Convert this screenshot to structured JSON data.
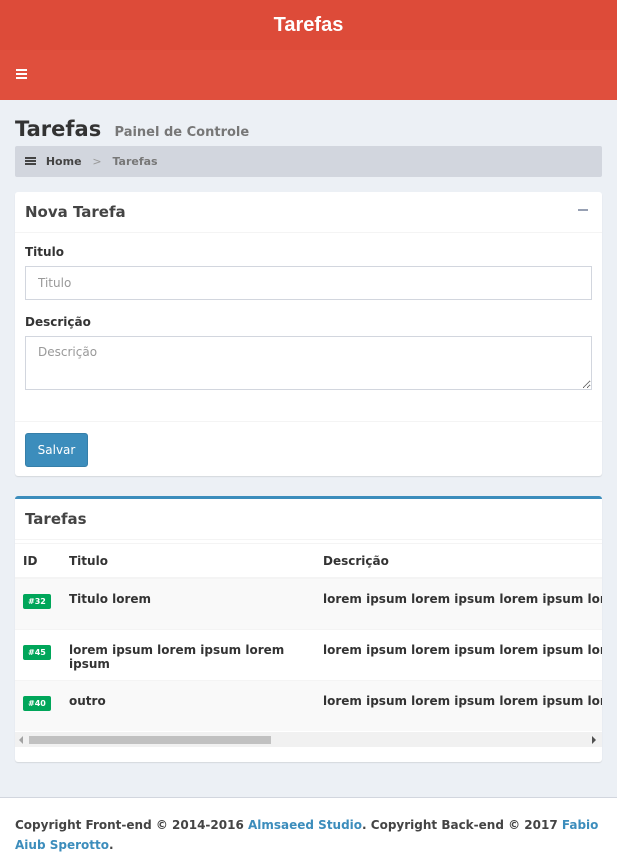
{
  "app": {
    "title": "Tarefas"
  },
  "header": {
    "title": "Tarefas",
    "subtitle": "Painel de Controle"
  },
  "breadcrumb": {
    "home": "Home",
    "separator": ">",
    "current": "Tarefas"
  },
  "form": {
    "box_title": "Nova Tarefa",
    "title_label": "Titulo",
    "title_placeholder": "Titulo",
    "description_label": "Descrição",
    "description_placeholder": "Descrição",
    "save_label": "Salvar"
  },
  "tasks": {
    "box_title": "Tarefas",
    "columns": [
      "ID",
      "Titulo",
      "Descrição"
    ],
    "rows": [
      {
        "id": "#32",
        "title": "Titulo lorem",
        "description": "lorem ipsum lorem ipsum lorem ipsum lorem"
      },
      {
        "id": "#45",
        "title": "lorem ipsum lorem ipsum lorem ipsum",
        "description": "lorem ipsum lorem ipsum lorem ipsum lorem"
      },
      {
        "id": "#40",
        "title": "outro",
        "description": "lorem ipsum lorem ipsum lorem ipsum lorem"
      }
    ]
  },
  "footer": {
    "front_prefix": "Copyright Front-end © 2014-2016 ",
    "front_author": "Almsaeed Studio",
    "back_prefix": ". Copyright Back-end © 2017 ",
    "back_author": "Fabio Aiub Sperotto",
    "suffix": "."
  },
  "colors": {
    "header_red": "#dd4b39",
    "primary_blue": "#3c8dbc",
    "badge_green": "#00a65a"
  },
  "icons": {
    "menu": "hamburger-icon",
    "breadcrumb": "dashboard-icon",
    "collapse": "minus-icon"
  }
}
